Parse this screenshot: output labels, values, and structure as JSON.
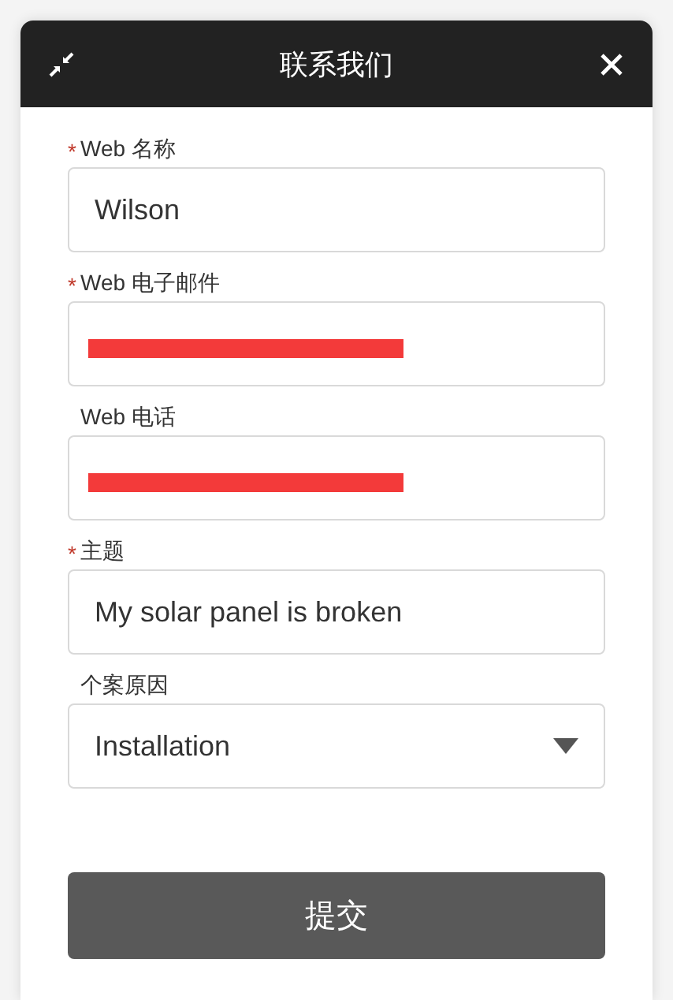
{
  "window": {
    "title": "联系我们"
  },
  "fields": [
    {
      "kind": "text",
      "label": "Web 名称",
      "required_mark": "*",
      "value": "Wilson"
    },
    {
      "kind": "text",
      "label": "Web 电子邮件",
      "required_mark": "*",
      "redacted": true
    },
    {
      "kind": "text",
      "label": "Web 电话",
      "redacted": true
    },
    {
      "kind": "text",
      "label": "主题",
      "required_mark": "*",
      "value": "My solar panel is broken"
    },
    {
      "kind": "select",
      "label": "个案原因",
      "value": "Installation"
    }
  ],
  "submit_button": "提交"
}
